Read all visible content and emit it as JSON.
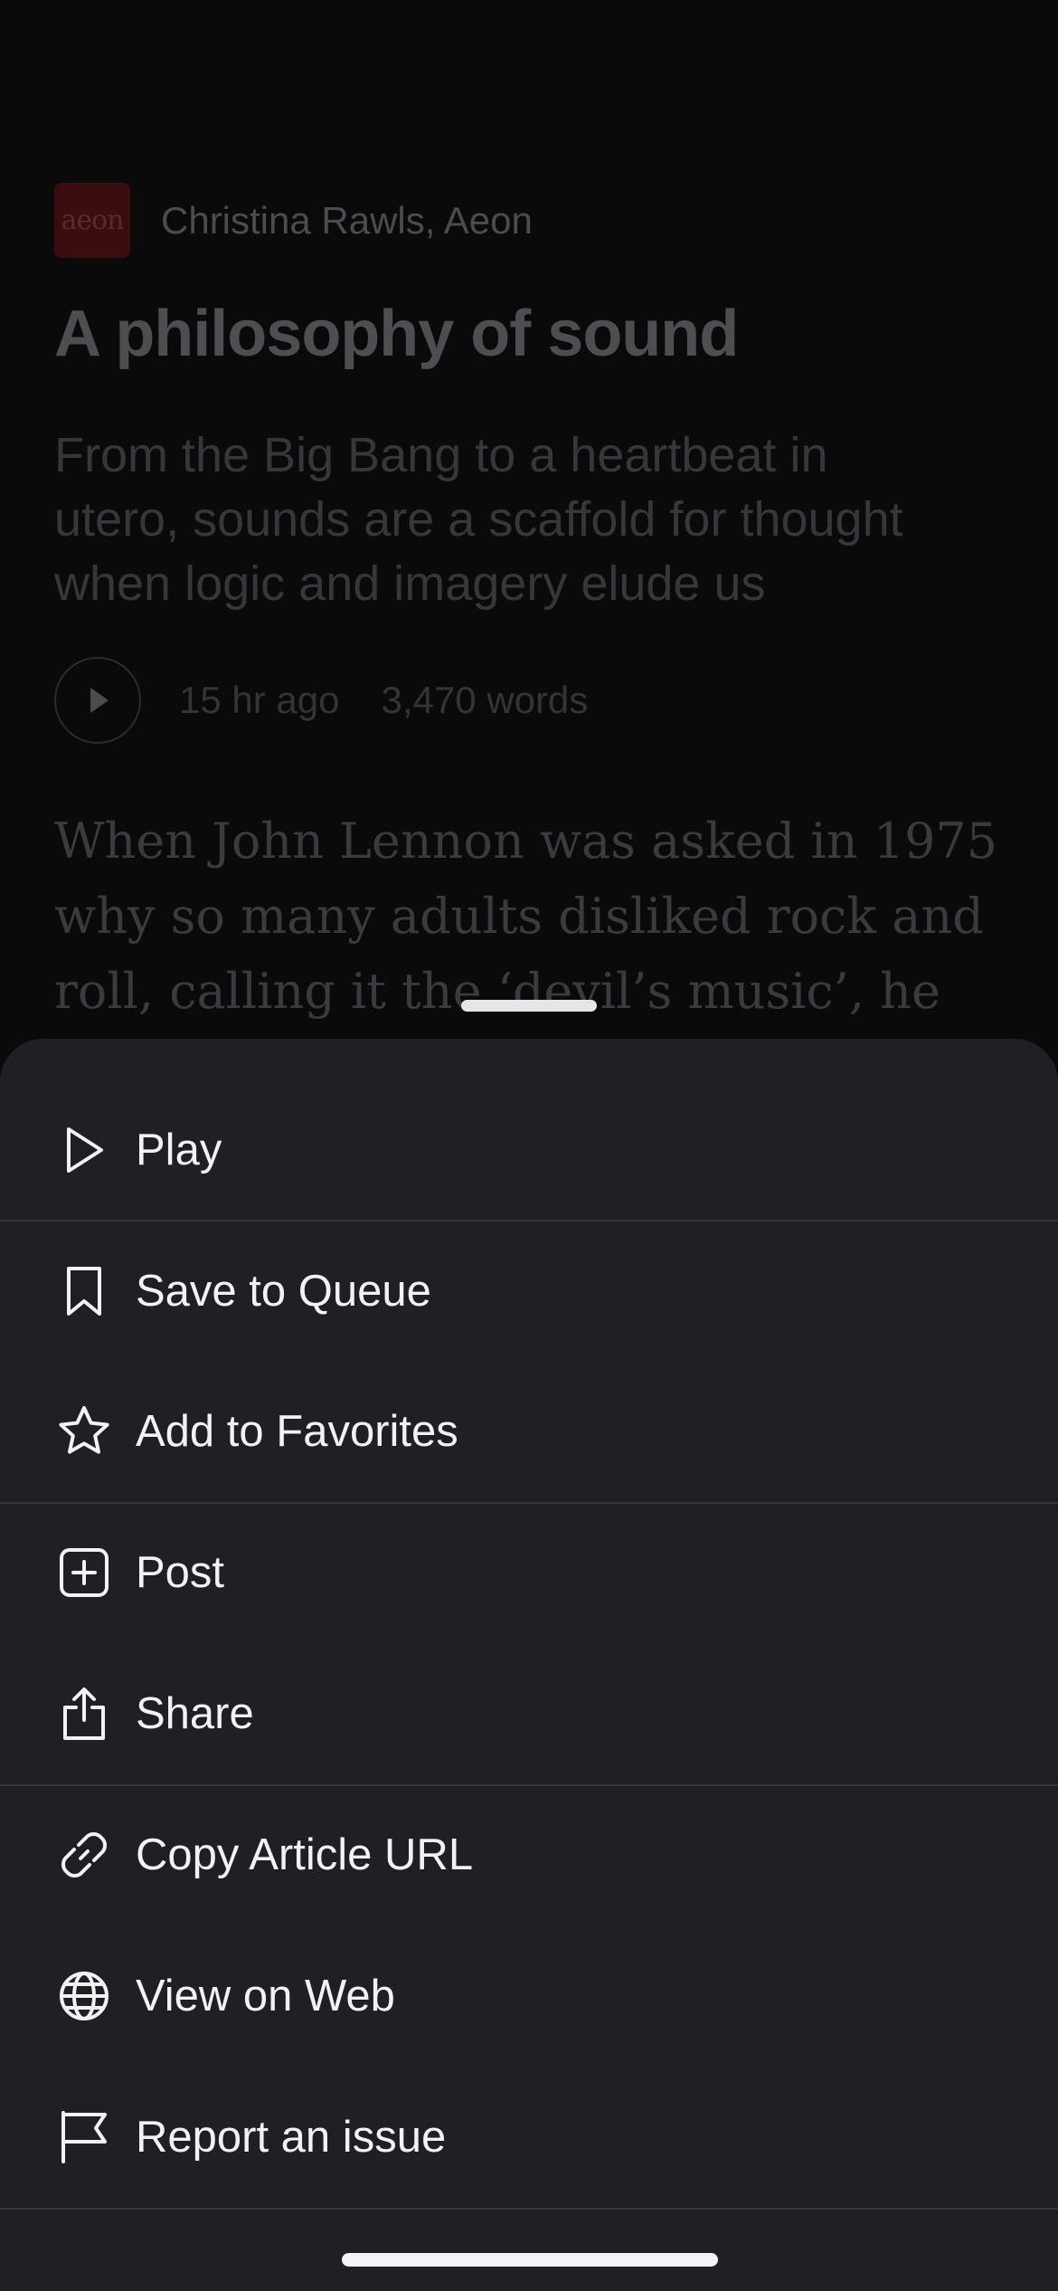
{
  "colors": {
    "background": "#0a0a0b",
    "sheet": "#1f2024",
    "divider": "#35363b",
    "menu_text": "#f2f2f4",
    "publisher_logo": "#3c0d10"
  },
  "article": {
    "publisher_logo_text": "aeon",
    "byline": "Christina Rawls, Aeon",
    "title": "A philosophy of sound",
    "subtitle": [
      "From the Big Bang to a heartbeat in",
      "utero, sounds are a scaffold for thought",
      "when logic and imagery elude us"
    ],
    "time_ago": "15 hr ago",
    "word_count": "3,470 words",
    "body_lines": [
      "When John Lennon was asked in 1975",
      "why so many adults disliked rock and",
      "roll, calling it the ‘devil’s music’, he"
    ]
  },
  "menu": {
    "items": [
      {
        "label": "Play",
        "icon": "play-icon"
      },
      {
        "label": "Save to Queue",
        "icon": "bookmark-icon"
      },
      {
        "label": "Add to Favorites",
        "icon": "star-icon"
      },
      {
        "label": "Post",
        "icon": "plus-square-icon"
      },
      {
        "label": "Share",
        "icon": "share-icon"
      },
      {
        "label": "Copy Article URL",
        "icon": "link-icon"
      },
      {
        "label": "View on Web",
        "icon": "globe-icon"
      },
      {
        "label": "Report an issue",
        "icon": "flag-icon"
      }
    ]
  }
}
